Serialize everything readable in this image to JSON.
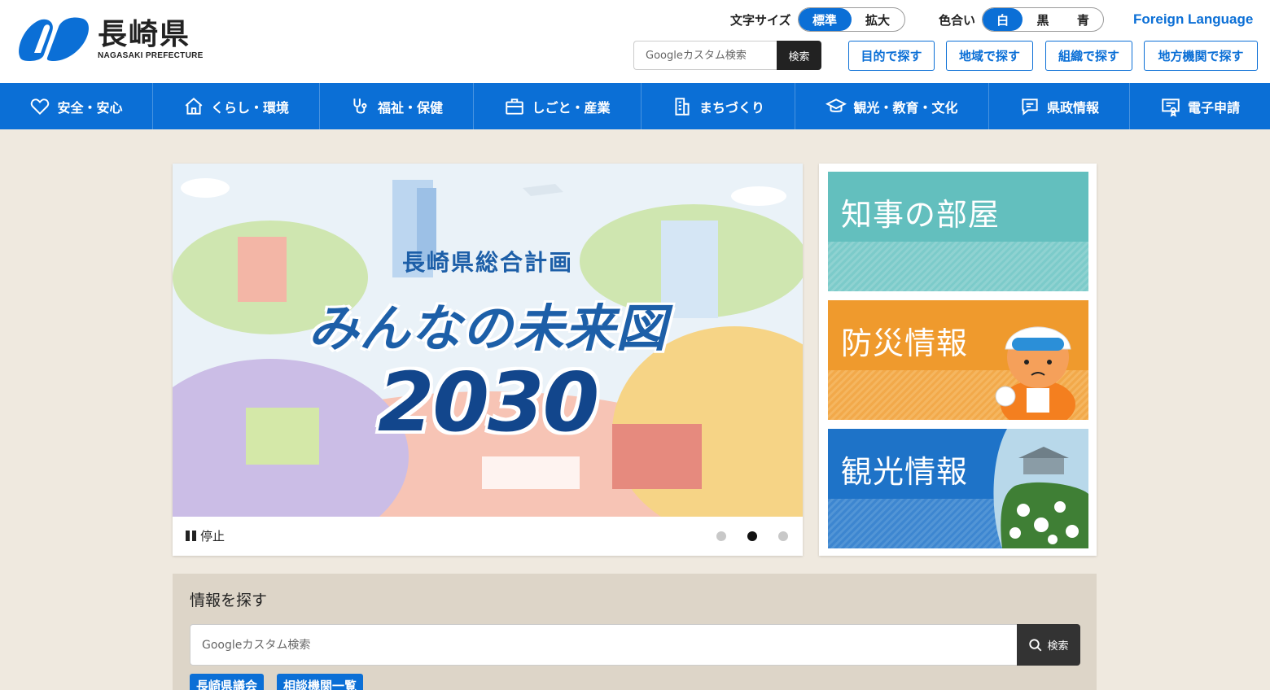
{
  "logo": {
    "jp": "長崎県",
    "en": "NAGASAKI PREFECTURE"
  },
  "header": {
    "font_size": {
      "label": "文字サイズ",
      "options": [
        "標準",
        "拡大"
      ],
      "selected": "標準"
    },
    "color": {
      "label": "色合い",
      "options": [
        "白",
        "黒",
        "青"
      ],
      "selected": "白"
    },
    "foreign_language": "Foreign Language",
    "search": {
      "placeholder": "Googleカスタム検索",
      "button": "検索"
    },
    "find_buttons": [
      "目的で探す",
      "地域で探す",
      "組織で探す",
      "地方機関で探す"
    ]
  },
  "nav": {
    "items": [
      {
        "label": "安全・安心",
        "icon": "heart-icon"
      },
      {
        "label": "くらし・環境",
        "icon": "home-icon"
      },
      {
        "label": "福祉・保健",
        "icon": "stethoscope-icon"
      },
      {
        "label": "しごと・産業",
        "icon": "briefcase-icon"
      },
      {
        "label": "まちづくり",
        "icon": "building-icon"
      },
      {
        "label": "観光・教育・文化",
        "icon": "graduation-cap-icon"
      },
      {
        "label": "県政情報",
        "icon": "speech-bubble-icon"
      },
      {
        "label": "電子申請",
        "icon": "certificate-icon"
      }
    ]
  },
  "slider": {
    "subtitle": "長崎県総合計画",
    "title": "みんなの未来図",
    "year": "2030",
    "pause_label": "停止",
    "dots": 3,
    "active_dot": 2
  },
  "banners": [
    {
      "label": "知事の部屋"
    },
    {
      "label": "防災情報"
    },
    {
      "label": "観光情報"
    }
  ],
  "info": {
    "title": "情報を探す",
    "search": {
      "placeholder": "Googleカスタム検索",
      "button": "検索"
    },
    "tags": [
      "長崎県議会",
      "相談機関一覧"
    ]
  },
  "colors": {
    "brand": "#0b6fd6",
    "background": "#efe9df"
  }
}
